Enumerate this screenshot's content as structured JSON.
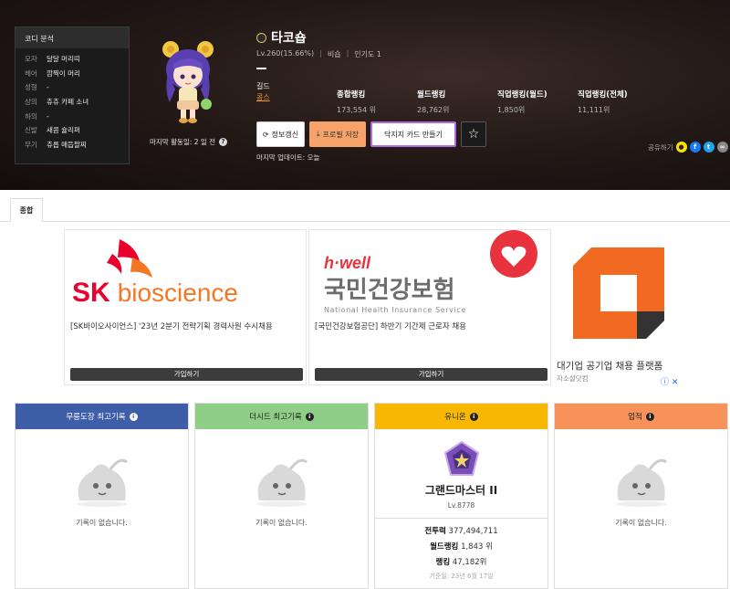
{
  "coordi": {
    "title": "코디 분석",
    "items": [
      {
        "k": "모자",
        "v": "달달 머리띠"
      },
      {
        "k": "헤어",
        "v": "깜찍이 머리"
      },
      {
        "k": "성형",
        "v": "-"
      },
      {
        "k": "상의",
        "v": "츄츄 카페 소녀"
      },
      {
        "k": "하의",
        "v": "-"
      },
      {
        "k": "신발",
        "v": "새콤 슐리퍼"
      },
      {
        "k": "무기",
        "v": "츄릅 매듭팔찌"
      }
    ]
  },
  "profile": {
    "activity_label": "마지막 활동일: 2 일 전",
    "name": "타코숍",
    "level": "Lv.260(15.66%)",
    "job": "비숍",
    "popularity": "인기도 1",
    "guild_label": "길드",
    "guild_name": "콩스"
  },
  "rankings": [
    {
      "label": "종합랭킹",
      "value": "173,554 위"
    },
    {
      "label": "월드랭킹",
      "value": "28,762위"
    },
    {
      "label": "직업랭킹(월드)",
      "value": "1,850위"
    },
    {
      "label": "직업랭킹(전체)",
      "value": "11,111위"
    }
  ],
  "buttons": {
    "refresh": "정보갱신",
    "save": "프로필 저장",
    "card": "닥지지 카드 만들기",
    "favorite_icon": "star-icon"
  },
  "last_update": "마지막 업데이트: 오늘",
  "share_label": "공유하기",
  "tabs": [
    "종합"
  ],
  "ads": [
    {
      "brand_a": "SK",
      "brand_b": "bioscience",
      "text": "[SK바이오사이언스] '23년 2분기 전략기획 경력사원 수시채용",
      "button": "가입하기"
    },
    {
      "brand_a": "h·well",
      "brand_b": "국민건강보험",
      "brand_sub": "National Health Insurance Service",
      "text": "[국민건강보험공단] 하반기 기간제 근로자 채용",
      "button": "가입하기"
    },
    {
      "text": "대기업 공기업 채용 플랫폼",
      "sub": "자소설닷컴"
    }
  ],
  "panels": {
    "dojang": {
      "title": "무릉도장 최고기록",
      "empty": "기록이 없습니다.",
      "color": "#3f5ea8"
    },
    "seed": {
      "title": "더시드 최고기록",
      "empty": "기록이 없습니다.",
      "color": "#8fce86"
    },
    "union": {
      "title": "유니온",
      "color": "#f8b703",
      "grade": "그랜드마스터 II",
      "level": "Lv.8778",
      "power_label": "전투력",
      "power": "377,494,711",
      "world_rank_label": "월드랭킹",
      "world_rank": "1,843 위",
      "rank_label": "랭킹",
      "rank": "47,182위",
      "date": "기준일: 23년 6월 17일"
    },
    "achievement": {
      "title": "업적",
      "empty": "기록이 없습니다.",
      "color": "#f7935a"
    }
  }
}
